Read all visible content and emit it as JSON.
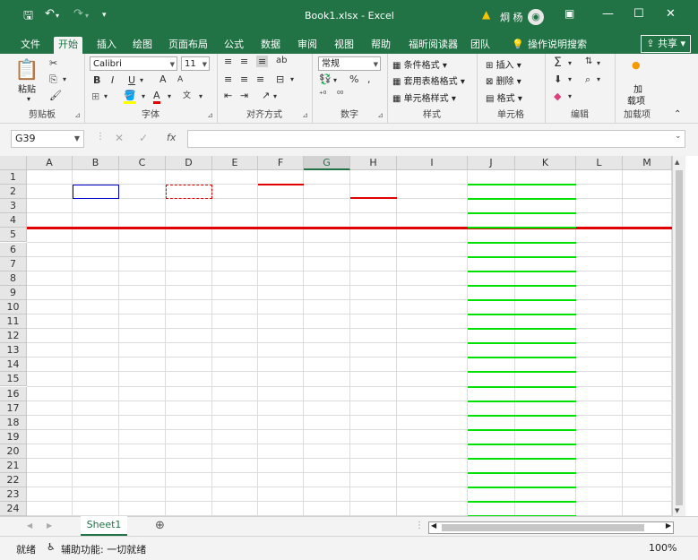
{
  "titlebar": {
    "save_icon": "save-icon",
    "undo_icon": "undo-icon",
    "redo_icon": "redo-icon",
    "title": "Book1.xlsx  -  Excel",
    "user": "炯 杨",
    "warning_icon": "warning-icon"
  },
  "tabs": [
    "文件",
    "开始",
    "插入",
    "绘图",
    "页面布局",
    "公式",
    "数据",
    "审阅",
    "视图",
    "帮助",
    "福昕阅读器",
    "团队",
    "操作说明搜索"
  ],
  "active_tab": "开始",
  "share_label": "共享",
  "ribbon": {
    "clipboard": {
      "paste": "粘贴",
      "label": "剪贴板"
    },
    "font": {
      "name": "Calibri",
      "size": "11",
      "label": "字体",
      "bold": "B",
      "italic": "I",
      "underline": "U",
      "grow": "A",
      "shrink": "A"
    },
    "align": {
      "label": "对齐方式"
    },
    "number": {
      "format": "常规",
      "percent": "%",
      "comma": ",",
      "label": "数字"
    },
    "styles": {
      "cond": "条件格式",
      "table": "套用表格格式",
      "cell": "单元格样式",
      "label": "样式"
    },
    "cells": {
      "insert": "插入",
      "delete": "删除",
      "format": "格式",
      "label": "单元格"
    },
    "edit": {
      "label": "编辑"
    },
    "addins": {
      "btn_line1": "加",
      "btn_line2": "载项",
      "label": "加载项"
    }
  },
  "formula_bar": {
    "name_box": "G39",
    "fx": "fx",
    "value": ""
  },
  "grid": {
    "columns": [
      "A",
      "B",
      "C",
      "D",
      "E",
      "F",
      "G",
      "H",
      "I",
      "J",
      "K",
      "L",
      "M"
    ],
    "selected_column": "G",
    "rows": [
      "1",
      "2",
      "3",
      "4",
      "5",
      "6",
      "7",
      "8",
      "9",
      "10",
      "11",
      "12",
      "13",
      "14",
      "15",
      "16",
      "17",
      "18",
      "19",
      "20",
      "21",
      "22",
      "23",
      "24"
    ]
  },
  "sheet": {
    "tab": "Sheet1",
    "add_icon": "plus-icon"
  },
  "status": {
    "ready": "就绪",
    "accessibility": "辅助功能: 一切就绪",
    "zoom": "100%"
  },
  "colors": {
    "accent": "#217346",
    "red": "#e00000",
    "green": "#00e000",
    "blue": "#0000cc"
  }
}
